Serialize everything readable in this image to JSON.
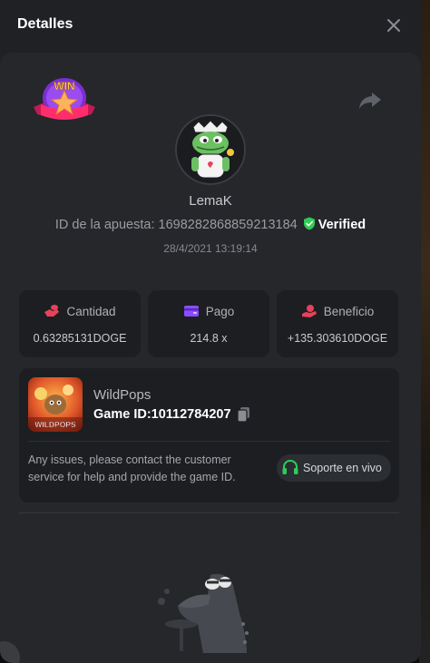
{
  "modal": {
    "title": "Detalles"
  },
  "badge": {
    "text": "WIN"
  },
  "user": {
    "name": "LemaK",
    "bet_id_label": "ID de la apuesta: 1698282868859213184",
    "verified_label": "Verified",
    "timestamp": "28/4/2021 13:19:14"
  },
  "stats": [
    {
      "label": "Cantidad",
      "value": "0.63285131DOGE",
      "icon": "coins-icon",
      "color": "#e8415b"
    },
    {
      "label": "Pago",
      "value": "214.8 x",
      "icon": "wallet-icon",
      "color": "#8b4dff"
    },
    {
      "label": "Beneficio",
      "value": "+135.303610DOGE",
      "icon": "hand-coin-icon",
      "color": "#e8415b"
    }
  ],
  "game": {
    "name": "WildPops",
    "game_id_label": "Game ID:10112784207",
    "thumb_text": "WILDPOPS",
    "support_text": "Any issues, please contact the customer service for help and provide the game ID.",
    "support_button": "Soporte en vivo"
  },
  "colors": {
    "accent_green": "#2ecc57",
    "modal_bg": "#1f2125",
    "panel_bg": "#25272b",
    "card_bg": "#1c1e21"
  }
}
